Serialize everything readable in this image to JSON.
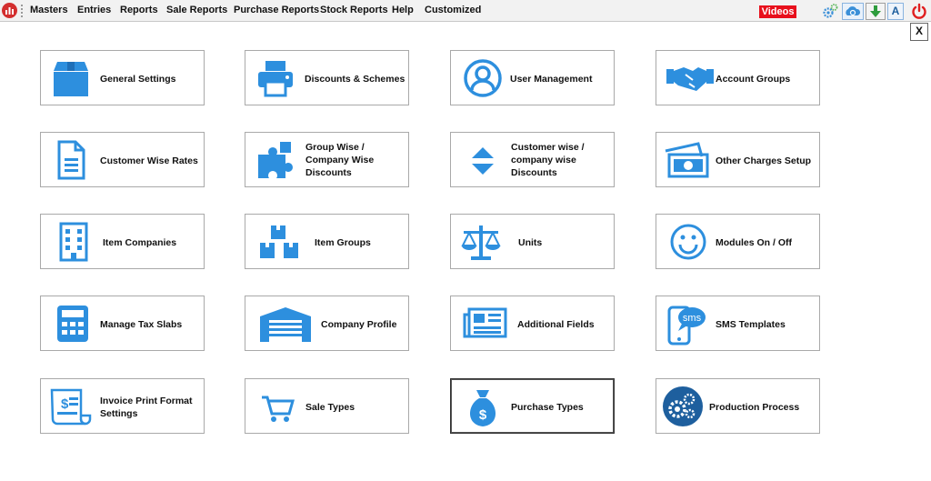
{
  "menubar": {
    "items": [
      "Masters",
      "Entries",
      "Reports",
      "Sale Reports",
      "Purchase Reports",
      "Stock Reports",
      "Help",
      "Customized"
    ],
    "videos_label": "Videos",
    "font_button_label": "A"
  },
  "window": {
    "close_label": "X"
  },
  "tiles": [
    {
      "label": "General Settings",
      "icon": "box-icon"
    },
    {
      "label": "Discounts & Schemes",
      "icon": "printer-icon"
    },
    {
      "label": "User Management",
      "icon": "user-circle-icon"
    },
    {
      "label": "Account Groups",
      "icon": "handshake-icon"
    },
    {
      "label": "Customer Wise Rates",
      "icon": "document-icon"
    },
    {
      "label": "Group Wise / Company Wise Discounts",
      "icon": "puzzle-icon"
    },
    {
      "label": "Customer wise / company wise Discounts",
      "icon": "sort-arrows-icon"
    },
    {
      "label": "Other Charges Setup",
      "icon": "money-icon"
    },
    {
      "label": "Item Companies",
      "icon": "building-icon"
    },
    {
      "label": "Item Groups",
      "icon": "boxes-icon"
    },
    {
      "label": "Units",
      "icon": "balance-scale-icon"
    },
    {
      "label": "Modules On / Off",
      "icon": "smiley-icon"
    },
    {
      "label": "Manage Tax Slabs",
      "icon": "calculator-icon"
    },
    {
      "label": "Company Profile",
      "icon": "warehouse-icon"
    },
    {
      "label": "Additional Fields",
      "icon": "newspaper-icon"
    },
    {
      "label": "SMS Templates",
      "icon": "sms-phone-icon"
    },
    {
      "label": "Invoice Print Format Settings",
      "icon": "invoice-icon"
    },
    {
      "label": "Sale Types",
      "icon": "cart-icon"
    },
    {
      "label": "Purchase Types",
      "icon": "money-bag-icon"
    },
    {
      "label": "Production Process",
      "icon": "gears-icon"
    }
  ],
  "sms_icon_text": "sms",
  "money_bag_symbol": "$",
  "colors": {
    "accent_blue": "#2d8fde",
    "dark_blue": "#1e5f9e",
    "videos_red": "#e8101c",
    "power_red": "#e02020"
  }
}
